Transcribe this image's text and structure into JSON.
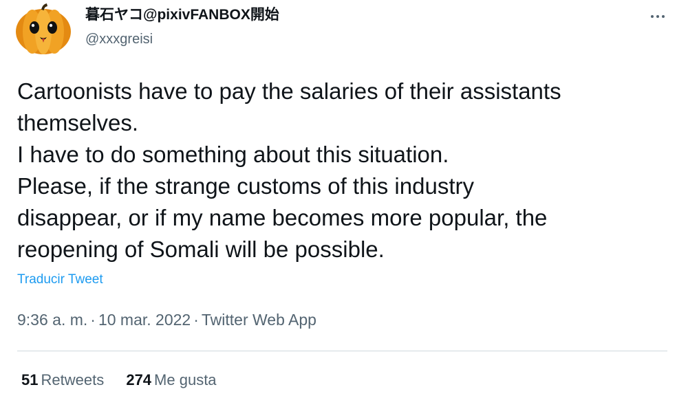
{
  "author": {
    "display_name": "暮石ヤコ@pixivFANBOX開始",
    "handle": "@xxxgreisi",
    "avatar": "pumpkin-avatar"
  },
  "menu": {
    "more_icon": "more-horizontal-icon"
  },
  "tweet": {
    "lines": [
      "Cartoonists have to pay the salaries of their assistants",
      "themselves.",
      "I have to do something about this situation.",
      "Please, if the strange customs of this industry",
      "disappear, or if my name becomes more popular, the",
      "reopening of Somali will be possible."
    ],
    "translate_label": "Traducir Tweet"
  },
  "meta": {
    "time": "9:36 a. m.",
    "separator": "·",
    "date": "10 mar. 2022",
    "source": "Twitter Web App"
  },
  "stats": {
    "retweets_count": "51",
    "retweets_label": "Retweets",
    "likes_count": "274",
    "likes_label": "Me gusta"
  },
  "colors": {
    "link": "#1d9bf0",
    "text": "#0f1419",
    "secondary": "#536471",
    "divider": "#cfd9de"
  }
}
